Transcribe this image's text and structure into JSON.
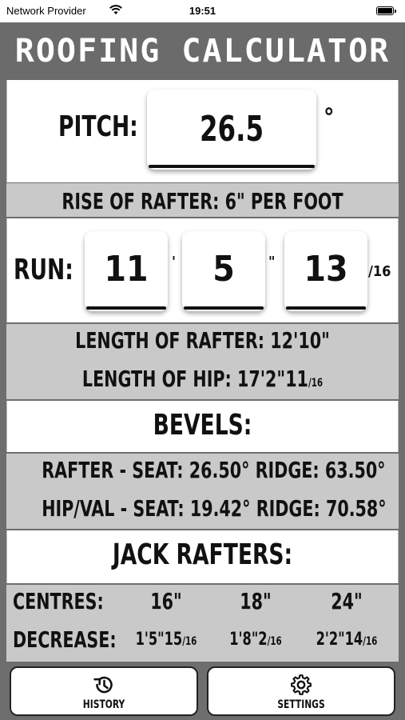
{
  "status": {
    "carrier": "Network Provider",
    "time": "19:51"
  },
  "header": {
    "title": "ROOFING CALCULATOR"
  },
  "pitch": {
    "label": "PITCH:",
    "value": "26.5",
    "unit": "°"
  },
  "rise": {
    "text": "RISE OF RAFTER: 6\" PER FOOT"
  },
  "run": {
    "label": "RUN:",
    "feet": "11",
    "feet_sym": "'",
    "inches": "5",
    "inches_sym": "\"",
    "sixteenths": "13",
    "suffix": "/16"
  },
  "lengths": {
    "rafter": "LENGTH OF RAFTER: 12'10\"",
    "hip_main": "LENGTH OF HIP: 17'2\"11",
    "hip_frac": "/16"
  },
  "bevels": {
    "heading": "BEVELS:",
    "rafter": "RAFTER - SEAT: 26.50° RIDGE: 63.50°",
    "hip": "HIP/VAL - SEAT: 19.42° RIDGE: 70.58°"
  },
  "jack": {
    "heading": "JACK RAFTERS:",
    "centres_label": "CENTRES:",
    "centres": [
      "16\"",
      "18\"",
      "24\""
    ],
    "decrease_label": "DECREASE:",
    "decrease": [
      {
        "main": "1'5\"15",
        "frac": "/16"
      },
      {
        "main": "1'8\"2",
        "frac": "/16"
      },
      {
        "main": "2'2\"14",
        "frac": "/16"
      }
    ]
  },
  "buttons": {
    "history": "HISTORY",
    "settings": "SETTINGS"
  },
  "icons": {
    "history": "history-icon",
    "settings": "gear-icon",
    "wifi": "wifi-icon",
    "battery": "battery-icon"
  }
}
